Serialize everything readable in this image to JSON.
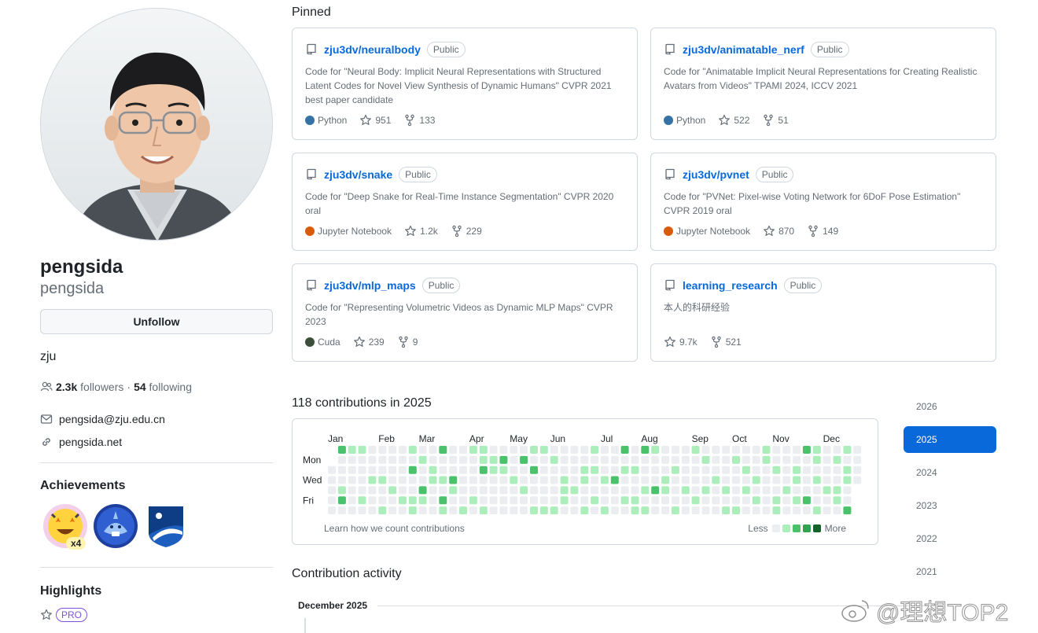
{
  "profile": {
    "name": "pengsida",
    "login": "pengsida",
    "unfollow_label": "Unfollow",
    "bio": "zju",
    "followers_count": "2.3k",
    "followers_label": "followers",
    "separator": "·",
    "following_count": "54",
    "following_label": "following",
    "email": "pengsida@zju.edu.cn",
    "website": "pengsida.net"
  },
  "achievements": {
    "title": "Achievements",
    "badges": [
      {
        "icon": "starstruck-badge-icon",
        "multiplier": "x4"
      },
      {
        "icon": "pull-shark-badge-icon"
      },
      {
        "icon": "yolo-badge-icon"
      }
    ]
  },
  "highlights": {
    "title": "Highlights",
    "pro_label": "PRO"
  },
  "pinned": {
    "title": "Pinned",
    "repos": [
      {
        "name": "zju3dv/neuralbody",
        "visibility": "Public",
        "description": "Code for \"Neural Body: Implicit Neural Representations with Structured Latent Codes for Novel View Synthesis of Dynamic Humans\" CVPR 2021 best paper candidate",
        "language": "Python",
        "lang_color": "#3572A5",
        "stars": "951",
        "forks": "133"
      },
      {
        "name": "zju3dv/animatable_nerf",
        "visibility": "Public",
        "description": "Code for \"Animatable Implicit Neural Representations for Creating Realistic Avatars from Videos\" TPAMI 2024, ICCV 2021",
        "language": "Python",
        "lang_color": "#3572A5",
        "stars": "522",
        "forks": "51"
      },
      {
        "name": "zju3dv/snake",
        "visibility": "Public",
        "description": "Code for \"Deep Snake for Real-Time Instance Segmentation\" CVPR 2020 oral",
        "language": "Jupyter Notebook",
        "lang_color": "#DA5B0B",
        "stars": "1.2k",
        "forks": "229"
      },
      {
        "name": "zju3dv/pvnet",
        "visibility": "Public",
        "description": "Code for \"PVNet: Pixel-wise Voting Network for 6DoF Pose Estimation\" CVPR 2019 oral",
        "language": "Jupyter Notebook",
        "lang_color": "#DA5B0B",
        "stars": "870",
        "forks": "149"
      },
      {
        "name": "zju3dv/mlp_maps",
        "visibility": "Public",
        "description": "Code for \"Representing Volumetric Videos as Dynamic MLP Maps\" CVPR 2023",
        "language": "Cuda",
        "lang_color": "#3A4E3A",
        "stars": "239",
        "forks": "9"
      },
      {
        "name": "learning_research",
        "visibility": "Public",
        "description": "本人的科研经验",
        "language": "",
        "lang_color": "",
        "stars": "9.7k",
        "forks": "521"
      }
    ]
  },
  "contributions": {
    "title": "118 contributions in 2025",
    "months": [
      "Jan",
      "Feb",
      "Mar",
      "Apr",
      "May",
      "Jun",
      "Jul",
      "Aug",
      "Sep",
      "Oct",
      "Nov",
      "Dec"
    ],
    "days": [
      "Mon",
      "Wed",
      "Fri"
    ],
    "learn_label": "Learn how we count contributions",
    "less_label": "Less",
    "more_label": "More",
    "level_colors": [
      "#ebedf0",
      "#aceebb",
      "#4ac26b",
      "#2da44e",
      "#116329"
    ],
    "weeks": [
      [
        0,
        0,
        0,
        0,
        0,
        0,
        0
      ],
      [
        1,
        0,
        0,
        0,
        0,
        2,
        1
      ],
      [
        0,
        0,
        0,
        0,
        0,
        0,
        0
      ],
      [
        1,
        0,
        0,
        0,
        0,
        0,
        0
      ],
      [
        0,
        0,
        0,
        0,
        0,
        0,
        0
      ],
      [
        0,
        0,
        0,
        0,
        1,
        0,
        0
      ],
      [
        0,
        0,
        0,
        0,
        0,
        2,
        0
      ],
      [
        0,
        0,
        0,
        0,
        0,
        0,
        0
      ],
      [
        0,
        0,
        0,
        0,
        0,
        0,
        0
      ],
      [
        0,
        0,
        0,
        0,
        0,
        0,
        0
      ],
      [
        0,
        0,
        0,
        0,
        0,
        0,
        0
      ],
      [
        0,
        0,
        0,
        0,
        0,
        0,
        0
      ],
      [
        0,
        0,
        0,
        0,
        0,
        0,
        0
      ],
      [
        0,
        0,
        0,
        0,
        0,
        0,
        0
      ],
      [
        0,
        0,
        0,
        0,
        0,
        0,
        0
      ],
      [
        0,
        0,
        0,
        0,
        0,
        0,
        0
      ],
      [
        0,
        0,
        0,
        0,
        0,
        0,
        0
      ],
      [
        0,
        0,
        0,
        0,
        0,
        0,
        0
      ],
      [
        0,
        0,
        0,
        0,
        0,
        0,
        0
      ],
      [
        0,
        0,
        0,
        0,
        0,
        0,
        0
      ],
      [
        0,
        0,
        0,
        0,
        0,
        0,
        0
      ],
      [
        0,
        0,
        0,
        0,
        0,
        0,
        0
      ],
      [
        0,
        0,
        0,
        0,
        0,
        0,
        0
      ],
      [
        0,
        0,
        0,
        0,
        0,
        0,
        0
      ],
      [
        0,
        0,
        0,
        0,
        0,
        0,
        0
      ],
      [
        0,
        0,
        0,
        0,
        0,
        0,
        0
      ],
      [
        0,
        0,
        0,
        0,
        0,
        0,
        0
      ],
      [
        0,
        0,
        0,
        0,
        0,
        0,
        0
      ],
      [
        0,
        0,
        0,
        0,
        0,
        0,
        0
      ],
      [
        0,
        0,
        0,
        0,
        0,
        0,
        0
      ],
      [
        0,
        0,
        0,
        0,
        0,
        0,
        0
      ],
      [
        0,
        0,
        0,
        0,
        0,
        0,
        0
      ],
      [
        0,
        0,
        0,
        0,
        0,
        0,
        0
      ],
      [
        0,
        0,
        0,
        0,
        0,
        0,
        0
      ],
      [
        0,
        0,
        0,
        0,
        0,
        0,
        0
      ],
      [
        0,
        0,
        0,
        0,
        0,
        0,
        0
      ],
      [
        0,
        0,
        0,
        0,
        0,
        0,
        0
      ],
      [
        0,
        0,
        0,
        0,
        0,
        0,
        0
      ],
      [
        0,
        0,
        0,
        0,
        0,
        0,
        0
      ],
      [
        0,
        0,
        0,
        0,
        0,
        0,
        0
      ],
      [
        0,
        0,
        0,
        0,
        0,
        0,
        0
      ],
      [
        0,
        0,
        0,
        0,
        0,
        0,
        0
      ],
      [
        0,
        0,
        0,
        0,
        0,
        0,
        0
      ],
      [
        0,
        0,
        0,
        0,
        0,
        0,
        0
      ],
      [
        0,
        0,
        0,
        0,
        0,
        0,
        0
      ],
      [
        0,
        0,
        0,
        0,
        0,
        0,
        0
      ],
      [
        0,
        0,
        0,
        0,
        0,
        0,
        0
      ],
      [
        0,
        0,
        0,
        0,
        0,
        0,
        0
      ],
      [
        0,
        0,
        0,
        0,
        0,
        0,
        0
      ],
      [
        0,
        0,
        0,
        0,
        0,
        0,
        0
      ],
      [
        0,
        0,
        0,
        0,
        0,
        0,
        0
      ],
      [
        0,
        0,
        0,
        0,
        0,
        0,
        0
      ],
      [
        0,
        0,
        0,
        0,
        0,
        0,
        0
      ]
    ],
    "pattern": "0000000 2000120 1000000 1000010 0001000 0001001 0000100 0000010 1020011 0100210 0011000 2001021 0002100 0000001 1000010 1120001 0110000 0210000 0001000 0200100 1020001 1000001 0100001 0001110 0000100 0011001 1010010 0001001 0002000 2010010 0010011 2000101 1000200 0001100 0010001 0000100 1000010 0100100 0001000 0000101 0100001 0010100 0001010 1100000 0010011 0000100 0011010 2000020 1101001 0000100 0100110 1011002 0000000"
  },
  "years": [
    "2026",
    "2025",
    "2024",
    "2023",
    "2022",
    "2021"
  ],
  "active_year": "2025",
  "activity": {
    "title": "Contribution activity",
    "month_label": "December 2025"
  },
  "watermark": "@理想TOP2"
}
